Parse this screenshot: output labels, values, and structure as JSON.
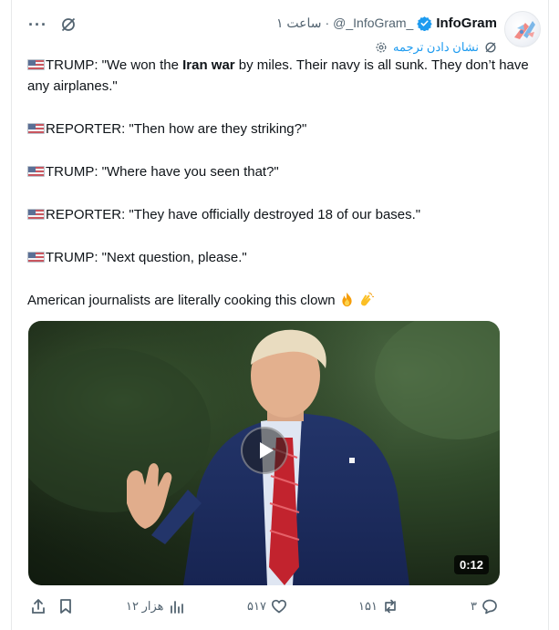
{
  "header": {
    "author_name": "InfoGram",
    "handle": "@_InfoGram_",
    "separator": "·",
    "time": "۱ ساعت",
    "translate_label": "نشان دادن ترجمه",
    "more_label": "···"
  },
  "tweet": {
    "lines": [
      {
        "prefix": "TRUMP: \"We won the ",
        "bold": "Iran war",
        "suffix": " by miles. Their navy is all sunk. They don’t have any airplanes.\""
      },
      {
        "prefix": "REPORTER: \"Then how are they striking?\"",
        "bold": "",
        "suffix": ""
      },
      {
        "prefix": "TRUMP: \"Where have you seen that?\"",
        "bold": "",
        "suffix": ""
      },
      {
        "prefix": "REPORTER: \"They have officially destroyed 18 of our bases.\"",
        "bold": "",
        "suffix": ""
      },
      {
        "prefix": "TRUMP: \"Next question, please.\"",
        "bold": "",
        "suffix": ""
      }
    ],
    "closing": "American journalists are literally cooking this clown"
  },
  "media": {
    "duration": "0:12"
  },
  "actions": {
    "views": "۱۲ هزار",
    "likes": "۵۱۷",
    "reposts": "۱۵۱",
    "replies": "۳"
  },
  "colors": {
    "accent": "#1d9bf0",
    "muted": "#536471",
    "text": "#0f1419"
  }
}
